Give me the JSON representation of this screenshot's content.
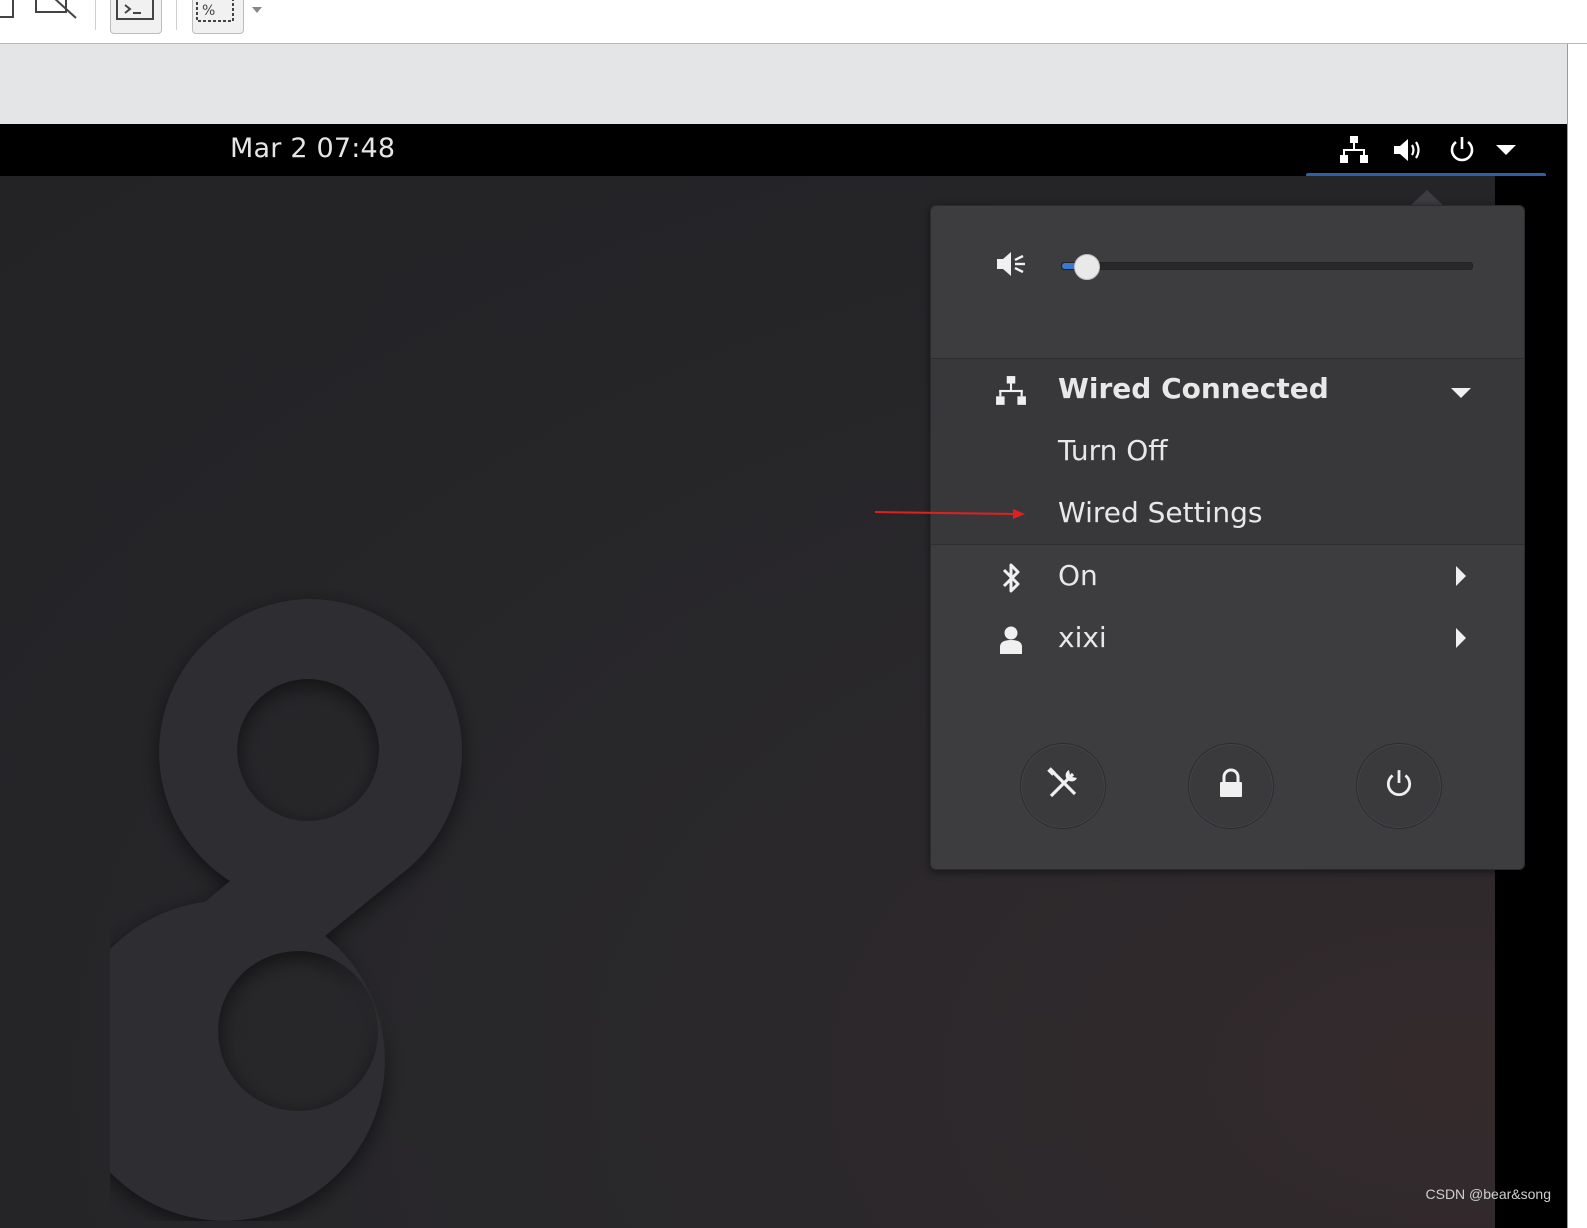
{
  "topbar": {
    "clock": "Mar 2  07:48",
    "tray_icons": [
      "network-wired-icon",
      "volume-icon",
      "power-icon",
      "dropdown-arrow-icon"
    ]
  },
  "menu": {
    "volume": {
      "icon": "volume-muted-icon",
      "level_fraction": 0.06
    },
    "network": {
      "title": "Wired Connected",
      "icon": "network-wired-icon",
      "items": [
        "Turn Off",
        "Wired Settings"
      ]
    },
    "bluetooth": {
      "label": "On",
      "icon": "bluetooth-icon"
    },
    "user": {
      "label": "xixi",
      "icon": "user-icon"
    },
    "actions": [
      {
        "name": "settings",
        "icon": "tools-icon"
      },
      {
        "name": "lock",
        "icon": "lock-icon"
      },
      {
        "name": "power",
        "icon": "power-icon"
      }
    ]
  },
  "colors": {
    "menu_bg": "#3d3d40",
    "accent": "#3b78cf",
    "annotation_arrow": "#e02020"
  },
  "watermark": "CSDN @bear&song"
}
